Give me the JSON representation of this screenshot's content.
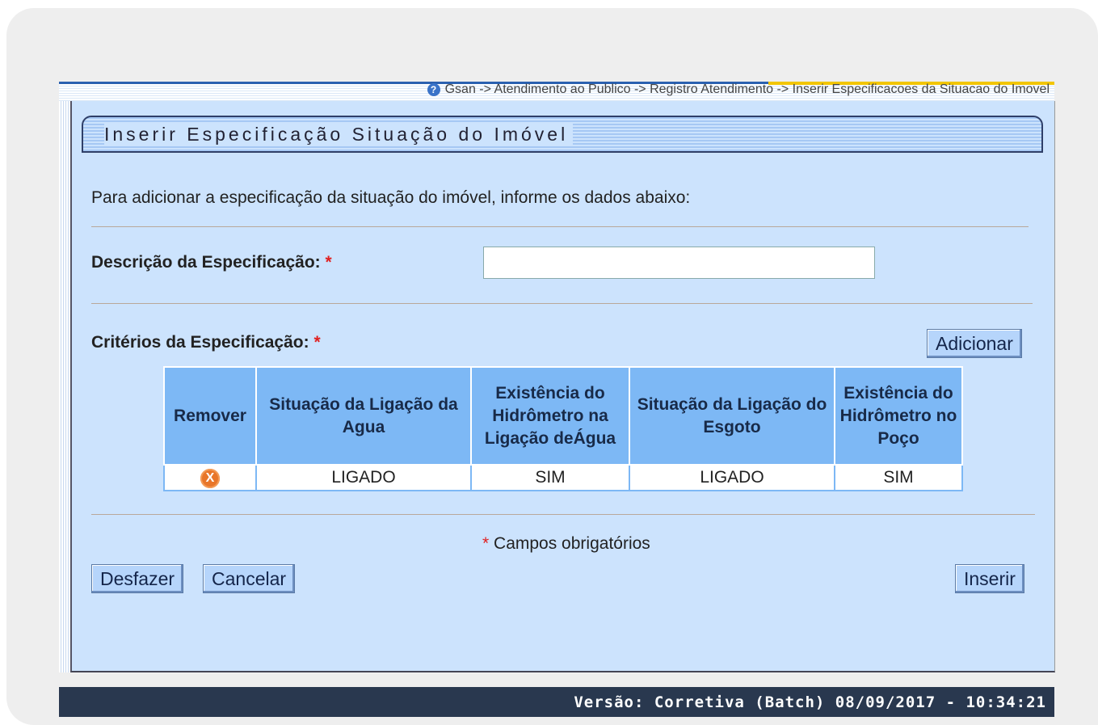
{
  "breadcrumb": "Gsan -> Atendimento ao Publico -> Registro Atendimento -> Inserir Especificacoes da Situacao do Imovel",
  "page_title": "Inserir Especificação Situação do Imóvel",
  "intro_text": "Para adicionar a especificação da situação do imóvel, informe os dados abaixo:",
  "form": {
    "descricao_label": "Descrição da Especificação:",
    "descricao_value": "",
    "criterios_label": "Critérios da Especificação:",
    "required_mark": "*"
  },
  "buttons": {
    "adicionar": "Adicionar",
    "desfazer": "Desfazer",
    "cancelar": "Cancelar",
    "inserir": "Inserir"
  },
  "table": {
    "headers": [
      "Remover",
      "Situação da Ligação da Agua",
      "Existência do Hidrômetro na Ligação deÁgua",
      "Situação da Ligação do Esgoto",
      "Existência do Hidrômetro no Poço"
    ],
    "rows": [
      {
        "remove_icon": "remove-icon",
        "situacao_agua": "LIGADO",
        "hidrometro_agua": "SIM",
        "situacao_esgoto": "LIGADO",
        "hidrometro_poco": "SIM"
      }
    ]
  },
  "required_note": "Campos obrigatórios",
  "footer_version": "Versão: Corretiva (Batch) 08/09/2017 - 10:34:21",
  "colors": {
    "panel_bg": "#cce3fd",
    "table_header_bg": "#7db8f5",
    "footer_bg": "#29384f",
    "required_red": "#e02020",
    "remove_icon_orange": "#e8762a"
  }
}
